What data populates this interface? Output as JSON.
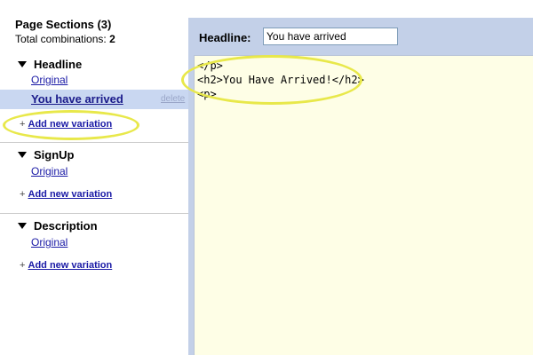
{
  "sidebar": {
    "title": "Page Sections (3)",
    "combinations_label": "Total combinations:",
    "combinations_value": "2",
    "sections": [
      {
        "name": "Headline",
        "variations": [
          "Original",
          "You have arrived"
        ],
        "delete_label": "delete",
        "add_label": "Add new variation"
      },
      {
        "name": "SignUp",
        "variations": [
          "Original"
        ],
        "add_label": "Add new variation"
      },
      {
        "name": "Description",
        "variations": [
          "Original"
        ],
        "add_label": "Add new variation"
      }
    ],
    "plus_sign": "+"
  },
  "editor": {
    "field_label": "Headline:",
    "field_value": "You have arrived",
    "code_lines": [
      "</p>",
      "<h2>You Have Arrived!</h2>",
      "<p>"
    ]
  },
  "colors": {
    "selected_row": "#c9d7f1",
    "panel_bg": "#c3d0e8",
    "code_bg": "#fefee6",
    "highlight": "#e8e84a",
    "link": "#1a1aa6"
  }
}
